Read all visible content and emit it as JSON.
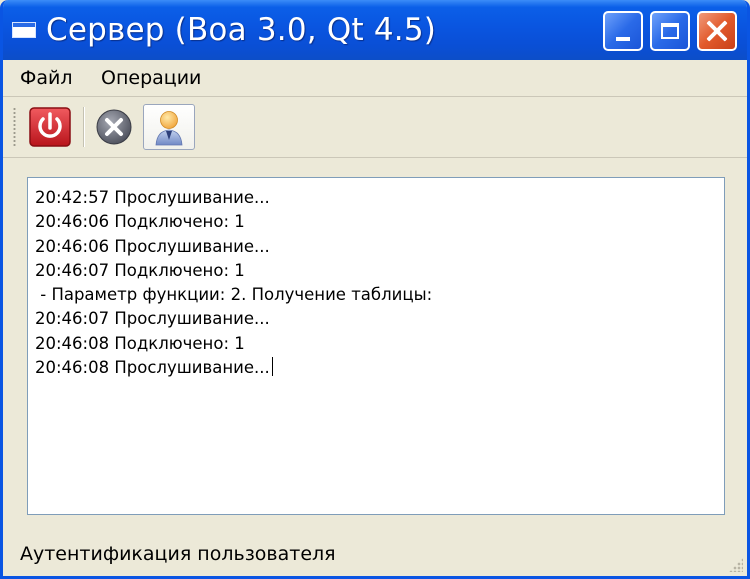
{
  "window": {
    "title": "Сервер (Boa 3.0, Qt 4.5)"
  },
  "menu": {
    "file_label": "Файл",
    "operations_label": "Операции"
  },
  "toolbar": {
    "buttons": [
      {
        "icon": "power-icon"
      },
      {
        "icon": "stop-icon"
      },
      {
        "icon": "user-icon"
      }
    ]
  },
  "log": {
    "lines": [
      "20:42:57 Прослушивание...",
      "20:46:06 Подключено: 1",
      "20:46:06 Прослушивание...",
      "20:46:07 Подключено: 1",
      " - Параметр функции: 2. Получение таблицы:",
      "20:46:07 Прослушивание...",
      "20:46:08 Подключено: 1",
      "20:46:08 Прослушивание..."
    ]
  },
  "status": {
    "text": "Аутентификация пользователя"
  },
  "colors": {
    "title_bar": "#0a55e0",
    "close_button": "#e25a2c",
    "window_bg": "#ece9d8",
    "power_button": "#d6282e"
  }
}
